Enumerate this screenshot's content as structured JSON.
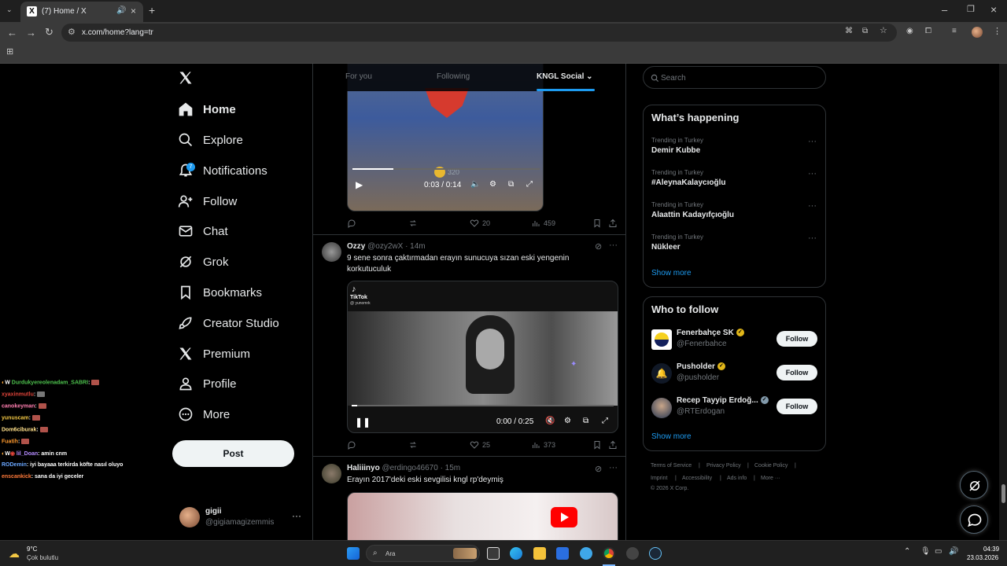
{
  "browser": {
    "tab_title": "(7) Home / X",
    "url": "x.com/home?lang=tr"
  },
  "nav": {
    "items": [
      {
        "label": "Home",
        "icon": "home-icon"
      },
      {
        "label": "Explore",
        "icon": "search-icon"
      },
      {
        "label": "Notifications",
        "icon": "bell-icon",
        "badge": "7"
      },
      {
        "label": "Follow",
        "icon": "add-user-icon"
      },
      {
        "label": "Chat",
        "icon": "mail-icon"
      },
      {
        "label": "Grok",
        "icon": "grok-icon"
      },
      {
        "label": "Bookmarks",
        "icon": "bookmark-icon"
      },
      {
        "label": "Creator Studio",
        "icon": "rocket-icon"
      },
      {
        "label": "Premium",
        "icon": "x-logo-icon"
      },
      {
        "label": "Profile",
        "icon": "person-icon"
      },
      {
        "label": "More",
        "icon": "more-circle-icon"
      }
    ],
    "post_label": "Post",
    "account": {
      "name": "gigii",
      "handle": "@gigiamagizemmis"
    }
  },
  "timeline": {
    "tabs": [
      "For you",
      "Following",
      "KNGL Social"
    ],
    "tweet1": {
      "time": "0:03 / 0:14",
      "views": "320",
      "likes": "20",
      "analytics": "459"
    },
    "tweet2": {
      "name": "Ozzy",
      "handle": "@ozy2wX",
      "age": "· 14m",
      "text": "9 sene sonra çaktırmadan erayın sunucuya sızan eski yengenin korkutuculuk",
      "tiktok_label": "TikTok",
      "tiktok_user": "@ yunomrk",
      "time": "0:00 / 0:25",
      "likes": "25",
      "analytics": "373"
    },
    "tweet3": {
      "name": "Haliiinyo",
      "handle": "@erdingo46670",
      "age": "· 15m",
      "text": "Erayın 2017'deki eski sevgilisi kngl rp'deymiş"
    }
  },
  "right": {
    "search_placeholder": "Search",
    "happening_title": "What’s happening",
    "trends": [
      {
        "category": "Trending in Turkey",
        "name": "Demir Kubbe"
      },
      {
        "category": "Trending in Turkey",
        "name": "#AleynaKalaycıoğlu"
      },
      {
        "category": "Trending in Turkey",
        "name": "Alaattin Kadayıfçıoğlu"
      },
      {
        "category": "Trending in Turkey",
        "name": "Nükleer"
      }
    ],
    "show_more": "Show more",
    "wtf_title": "Who to follow",
    "wtf": [
      {
        "name": "Fenerbahçe SK",
        "handle": "@Fenerbahce",
        "button": "Follow"
      },
      {
        "name": "Pusholder",
        "handle": "@pusholder",
        "button": "Follow"
      },
      {
        "name": "Recep Tayyip Erdoğ...",
        "handle": "@RTErdogan",
        "button": "Follow"
      }
    ],
    "footer": [
      "Terms of Service",
      "Privacy Policy",
      "Cookie Policy",
      "Imprint",
      "Accessibility",
      "Ads info",
      "More ···",
      "© 2026 X Corp."
    ]
  },
  "chat": [
    {
      "user": "Durdukyereolenadam_SABRI",
      "msg": ":",
      "color": "#4ec34e"
    },
    {
      "user": "xyaxinmutlu",
      "msg": ":",
      "color": "#e0443a"
    },
    {
      "user": "canokeyman",
      "msg": ":",
      "color": "#ff7eb0"
    },
    {
      "user": "yunuscam",
      "msg": ":",
      "color": "#f2c744"
    },
    {
      "user": "Dom6ciburak",
      "msg": ":",
      "color": "#ffe08a"
    },
    {
      "user": "Fuatih",
      "msg": ":",
      "color": "#ff9a2e"
    },
    {
      "user": "lil_Doan",
      "msg": ": amin cnm",
      "color": "#b58cff"
    },
    {
      "user": "RODemin",
      "msg": ": iyi bayaaa terkirda köfte nasıl oluyo",
      "color": "#6aa7ff"
    },
    {
      "user": "enscankick",
      "msg": ": sana da iyi geceler",
      "color": "#ff7a3a"
    }
  ],
  "taskbar": {
    "weather_temp": "9°C",
    "weather_desc": "Çok bulutlu",
    "search": "Ara",
    "time": "04:39",
    "date": "23.03.2026"
  }
}
